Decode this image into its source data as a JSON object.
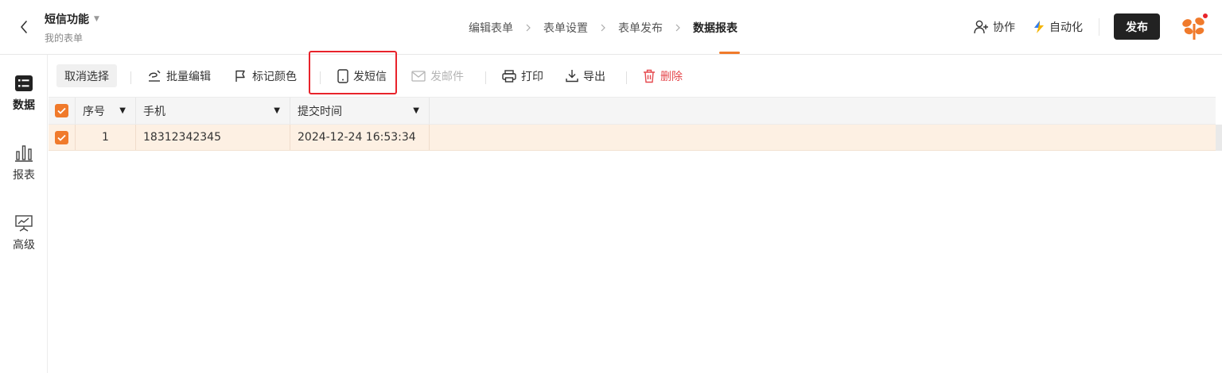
{
  "header": {
    "title": "短信功能",
    "subtitle": "我的表单",
    "steps": [
      {
        "label": "编辑表单"
      },
      {
        "label": "表单设置"
      },
      {
        "label": "表单发布"
      },
      {
        "label": "数据报表",
        "active": true
      }
    ],
    "collab_label": "协作",
    "auto_label": "自动化",
    "publish_label": "发布",
    "accent_color": "#f07a2b"
  },
  "rail": {
    "items": [
      {
        "label": "数据",
        "icon": "list-icon",
        "active": true
      },
      {
        "label": "报表",
        "icon": "bar-chart-icon"
      },
      {
        "label": "高级",
        "icon": "presentation-chart-icon"
      }
    ]
  },
  "toolbar": {
    "cancel_select": "取消选择",
    "batch_edit": "批量编辑",
    "mark_color": "标记颜色",
    "send_sms": "发短信",
    "send_email": "发邮件",
    "print": "打印",
    "export": "导出",
    "delete": "删除"
  },
  "table": {
    "columns": [
      "序号",
      "手机",
      "提交时间"
    ],
    "rows": [
      {
        "seq": "1",
        "phone": "18312342345",
        "time": "2024-12-24 16:53:34",
        "selected": true
      }
    ]
  }
}
